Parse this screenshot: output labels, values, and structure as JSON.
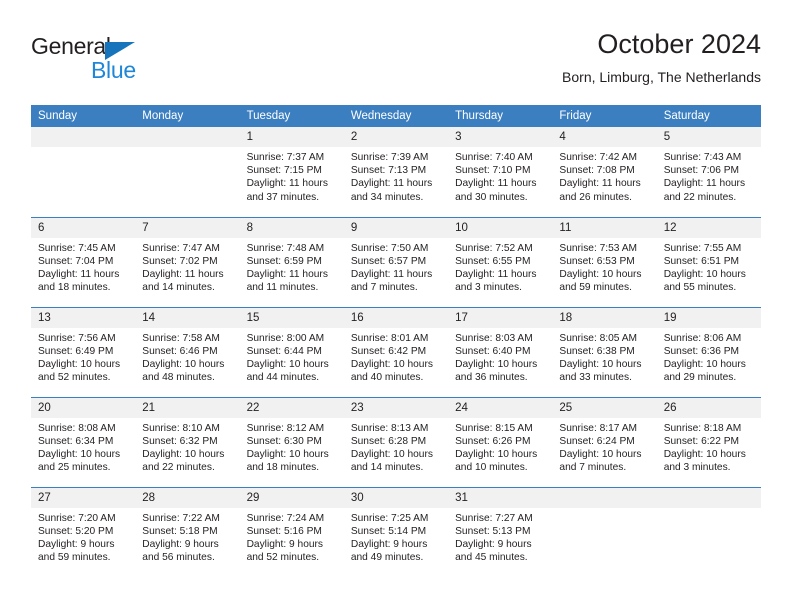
{
  "brand": {
    "name_part1": "General",
    "name_part2": "Blue",
    "triangle_icon": "triangle-icon",
    "accent_blue": "#1f87d8",
    "logo_triangle_blue": "#1574bb"
  },
  "header": {
    "title": "October 2024",
    "subtitle": "Born, Limburg, The Netherlands"
  },
  "theme": {
    "header_bg": "#3c7fc0",
    "daynum_bg": "#f1f1f1",
    "text": "#231f20"
  },
  "weekdays": [
    "Sunday",
    "Monday",
    "Tuesday",
    "Wednesday",
    "Thursday",
    "Friday",
    "Saturday"
  ],
  "weeks": [
    [
      {
        "day": ""
      },
      {
        "day": ""
      },
      {
        "day": "1",
        "sunrise": "Sunrise: 7:37 AM",
        "sunset": "Sunset: 7:15 PM",
        "daylight1": "Daylight: 11 hours",
        "daylight2": "and 37 minutes."
      },
      {
        "day": "2",
        "sunrise": "Sunrise: 7:39 AM",
        "sunset": "Sunset: 7:13 PM",
        "daylight1": "Daylight: 11 hours",
        "daylight2": "and 34 minutes."
      },
      {
        "day": "3",
        "sunrise": "Sunrise: 7:40 AM",
        "sunset": "Sunset: 7:10 PM",
        "daylight1": "Daylight: 11 hours",
        "daylight2": "and 30 minutes."
      },
      {
        "day": "4",
        "sunrise": "Sunrise: 7:42 AM",
        "sunset": "Sunset: 7:08 PM",
        "daylight1": "Daylight: 11 hours",
        "daylight2": "and 26 minutes."
      },
      {
        "day": "5",
        "sunrise": "Sunrise: 7:43 AM",
        "sunset": "Sunset: 7:06 PM",
        "daylight1": "Daylight: 11 hours",
        "daylight2": "and 22 minutes."
      }
    ],
    [
      {
        "day": "6",
        "sunrise": "Sunrise: 7:45 AM",
        "sunset": "Sunset: 7:04 PM",
        "daylight1": "Daylight: 11 hours",
        "daylight2": "and 18 minutes."
      },
      {
        "day": "7",
        "sunrise": "Sunrise: 7:47 AM",
        "sunset": "Sunset: 7:02 PM",
        "daylight1": "Daylight: 11 hours",
        "daylight2": "and 14 minutes."
      },
      {
        "day": "8",
        "sunrise": "Sunrise: 7:48 AM",
        "sunset": "Sunset: 6:59 PM",
        "daylight1": "Daylight: 11 hours",
        "daylight2": "and 11 minutes."
      },
      {
        "day": "9",
        "sunrise": "Sunrise: 7:50 AM",
        "sunset": "Sunset: 6:57 PM",
        "daylight1": "Daylight: 11 hours",
        "daylight2": "and 7 minutes."
      },
      {
        "day": "10",
        "sunrise": "Sunrise: 7:52 AM",
        "sunset": "Sunset: 6:55 PM",
        "daylight1": "Daylight: 11 hours",
        "daylight2": "and 3 minutes."
      },
      {
        "day": "11",
        "sunrise": "Sunrise: 7:53 AM",
        "sunset": "Sunset: 6:53 PM",
        "daylight1": "Daylight: 10 hours",
        "daylight2": "and 59 minutes."
      },
      {
        "day": "12",
        "sunrise": "Sunrise: 7:55 AM",
        "sunset": "Sunset: 6:51 PM",
        "daylight1": "Daylight: 10 hours",
        "daylight2": "and 55 minutes."
      }
    ],
    [
      {
        "day": "13",
        "sunrise": "Sunrise: 7:56 AM",
        "sunset": "Sunset: 6:49 PM",
        "daylight1": "Daylight: 10 hours",
        "daylight2": "and 52 minutes."
      },
      {
        "day": "14",
        "sunrise": "Sunrise: 7:58 AM",
        "sunset": "Sunset: 6:46 PM",
        "daylight1": "Daylight: 10 hours",
        "daylight2": "and 48 minutes."
      },
      {
        "day": "15",
        "sunrise": "Sunrise: 8:00 AM",
        "sunset": "Sunset: 6:44 PM",
        "daylight1": "Daylight: 10 hours",
        "daylight2": "and 44 minutes."
      },
      {
        "day": "16",
        "sunrise": "Sunrise: 8:01 AM",
        "sunset": "Sunset: 6:42 PM",
        "daylight1": "Daylight: 10 hours",
        "daylight2": "and 40 minutes."
      },
      {
        "day": "17",
        "sunrise": "Sunrise: 8:03 AM",
        "sunset": "Sunset: 6:40 PM",
        "daylight1": "Daylight: 10 hours",
        "daylight2": "and 36 minutes."
      },
      {
        "day": "18",
        "sunrise": "Sunrise: 8:05 AM",
        "sunset": "Sunset: 6:38 PM",
        "daylight1": "Daylight: 10 hours",
        "daylight2": "and 33 minutes."
      },
      {
        "day": "19",
        "sunrise": "Sunrise: 8:06 AM",
        "sunset": "Sunset: 6:36 PM",
        "daylight1": "Daylight: 10 hours",
        "daylight2": "and 29 minutes."
      }
    ],
    [
      {
        "day": "20",
        "sunrise": "Sunrise: 8:08 AM",
        "sunset": "Sunset: 6:34 PM",
        "daylight1": "Daylight: 10 hours",
        "daylight2": "and 25 minutes."
      },
      {
        "day": "21",
        "sunrise": "Sunrise: 8:10 AM",
        "sunset": "Sunset: 6:32 PM",
        "daylight1": "Daylight: 10 hours",
        "daylight2": "and 22 minutes."
      },
      {
        "day": "22",
        "sunrise": "Sunrise: 8:12 AM",
        "sunset": "Sunset: 6:30 PM",
        "daylight1": "Daylight: 10 hours",
        "daylight2": "and 18 minutes."
      },
      {
        "day": "23",
        "sunrise": "Sunrise: 8:13 AM",
        "sunset": "Sunset: 6:28 PM",
        "daylight1": "Daylight: 10 hours",
        "daylight2": "and 14 minutes."
      },
      {
        "day": "24",
        "sunrise": "Sunrise: 8:15 AM",
        "sunset": "Sunset: 6:26 PM",
        "daylight1": "Daylight: 10 hours",
        "daylight2": "and 10 minutes."
      },
      {
        "day": "25",
        "sunrise": "Sunrise: 8:17 AM",
        "sunset": "Sunset: 6:24 PM",
        "daylight1": "Daylight: 10 hours",
        "daylight2": "and 7 minutes."
      },
      {
        "day": "26",
        "sunrise": "Sunrise: 8:18 AM",
        "sunset": "Sunset: 6:22 PM",
        "daylight1": "Daylight: 10 hours",
        "daylight2": "and 3 minutes."
      }
    ],
    [
      {
        "day": "27",
        "sunrise": "Sunrise: 7:20 AM",
        "sunset": "Sunset: 5:20 PM",
        "daylight1": "Daylight: 9 hours",
        "daylight2": "and 59 minutes."
      },
      {
        "day": "28",
        "sunrise": "Sunrise: 7:22 AM",
        "sunset": "Sunset: 5:18 PM",
        "daylight1": "Daylight: 9 hours",
        "daylight2": "and 56 minutes."
      },
      {
        "day": "29",
        "sunrise": "Sunrise: 7:24 AM",
        "sunset": "Sunset: 5:16 PM",
        "daylight1": "Daylight: 9 hours",
        "daylight2": "and 52 minutes."
      },
      {
        "day": "30",
        "sunrise": "Sunrise: 7:25 AM",
        "sunset": "Sunset: 5:14 PM",
        "daylight1": "Daylight: 9 hours",
        "daylight2": "and 49 minutes."
      },
      {
        "day": "31",
        "sunrise": "Sunrise: 7:27 AM",
        "sunset": "Sunset: 5:13 PM",
        "daylight1": "Daylight: 9 hours",
        "daylight2": "and 45 minutes."
      },
      {
        "day": ""
      },
      {
        "day": ""
      }
    ]
  ]
}
